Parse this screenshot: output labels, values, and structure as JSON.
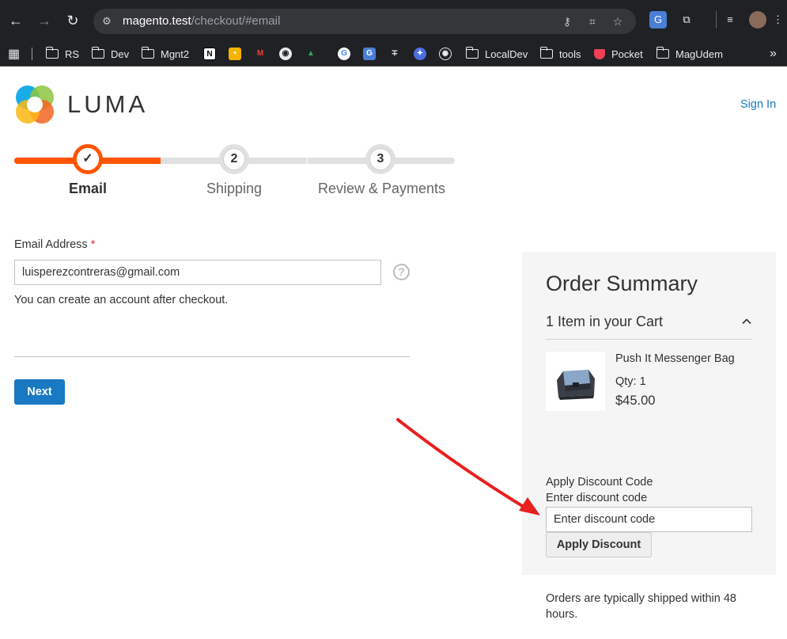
{
  "browser": {
    "url_host": "magento.test",
    "url_path": "/checkout/#email",
    "bookmarks": [
      {
        "label": "RS"
      },
      {
        "label": "Dev"
      },
      {
        "label": "Mgnt2"
      },
      {
        "label": "LocalDev"
      },
      {
        "label": "tools"
      },
      {
        "label": "Pocket"
      },
      {
        "label": "MagUdem"
      }
    ],
    "overflow": "»"
  },
  "header": {
    "logo_text": "LUMA",
    "sign_in": "Sign In"
  },
  "progress": {
    "steps": [
      {
        "number": "✓",
        "label": "Email",
        "active": true
      },
      {
        "number": "2",
        "label": "Shipping",
        "active": false
      },
      {
        "number": "3",
        "label": "Review & Payments",
        "active": false
      }
    ]
  },
  "form": {
    "email_label": "Email Address",
    "required_mark": "*",
    "email_value": "luisperezcontreras@gmail.com",
    "help": "?",
    "note": "You can create an account after checkout.",
    "next_label": "Next"
  },
  "summary": {
    "title": "Order Summary",
    "cart_count": "1 Item in your Cart",
    "item": {
      "name": "Push It Messenger Bag",
      "qty": "Qty: 1",
      "price": "$45.00"
    },
    "discount": {
      "title": "Apply Discount Code",
      "label": "Enter discount code",
      "placeholder": "Enter discount code",
      "button": "Apply Discount"
    },
    "shipping_note": "Orders are typically shipped within 48 hours."
  },
  "colors": {
    "accent": "#ff5501",
    "link": "#1979c3",
    "annotation_arrow": "#e8201e"
  }
}
